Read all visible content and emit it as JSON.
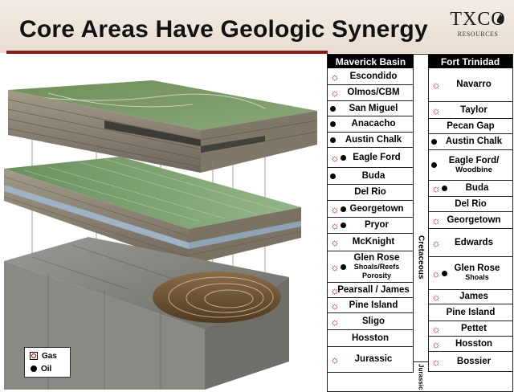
{
  "slide": {
    "title": "Core Areas Have Geologic Synergy",
    "logo_text": "TXCO",
    "logo_subtext": "RESOURCES",
    "colors": {
      "title_rule": "#8a1b1b",
      "gas_symbol": "#b02018",
      "oil_symbol": "#000000"
    }
  },
  "legend": [
    {
      "icon": "gas-icon",
      "label": "Gas"
    },
    {
      "icon": "oil-icon",
      "label": "Oil"
    }
  ],
  "table": {
    "columns": [
      "Maverick Basin",
      "Fort Trinidad"
    ],
    "periods": [
      "Cretaceous",
      "Jurassic"
    ],
    "maverick_basin": [
      {
        "name": "Escondido",
        "gas": true,
        "oil": false
      },
      {
        "name": "Olmos/CBM",
        "gas": true,
        "oil": false
      },
      {
        "name": "San Miguel",
        "gas": false,
        "oil": true
      },
      {
        "name": "Anacacho",
        "gas": false,
        "oil": true
      },
      {
        "name": "Austin Chalk",
        "gas": false,
        "oil": true
      },
      {
        "name": "Eagle Ford",
        "gas": true,
        "oil": true
      },
      {
        "name": "Buda",
        "gas": false,
        "oil": true
      },
      {
        "name": "Del Rio",
        "gas": false,
        "oil": false
      },
      {
        "name": "Georgetown",
        "gas": true,
        "oil": true
      },
      {
        "name": "Pryor",
        "gas": true,
        "oil": true
      },
      {
        "name": "McKnight",
        "gas": true,
        "oil": false
      },
      {
        "name": "Glen Rose",
        "sub": "Shoals/Reefs Porosity",
        "gas": true,
        "oil": true
      },
      {
        "name": "Pearsall / James",
        "gas": true,
        "oil": false
      },
      {
        "name": "Pine Island",
        "gas": true,
        "oil": false
      },
      {
        "name": "Sligo",
        "gas": true,
        "oil": false
      },
      {
        "name": "Hosston",
        "gas": false,
        "oil": false
      },
      {
        "name": "Jurassic",
        "gas": true,
        "oil": false
      }
    ],
    "fort_trinidad": [
      {
        "name": "Navarro",
        "gas": true,
        "oil": false
      },
      {
        "name": "Taylor",
        "gas": true,
        "oil": false
      },
      {
        "name": "Pecan Gap",
        "gas": false,
        "oil": false
      },
      {
        "name": "Austin Chalk",
        "gas": false,
        "oil": true
      },
      {
        "name": "Eagle Ford/",
        "sub": "Woodbine",
        "gas": false,
        "oil": true
      },
      {
        "name": "Buda",
        "gas": true,
        "oil": true
      },
      {
        "name": "Del Rio",
        "gas": false,
        "oil": false
      },
      {
        "name": "Georgetown",
        "gas": true,
        "oil": false
      },
      {
        "name": "Edwards",
        "gas": true,
        "oil": false
      },
      {
        "name": "Glen Rose",
        "sub": "Shoals",
        "gas": true,
        "oil": true
      },
      {
        "name": "James",
        "gas": true,
        "oil": false
      },
      {
        "name": "Pine Island",
        "gas": false,
        "oil": false
      },
      {
        "name": "Pettet",
        "gas": true,
        "oil": false
      },
      {
        "name": "Hosston",
        "gas": true,
        "oil": false
      },
      {
        "name": "Bossier",
        "gas": true,
        "oil": false
      }
    ]
  }
}
